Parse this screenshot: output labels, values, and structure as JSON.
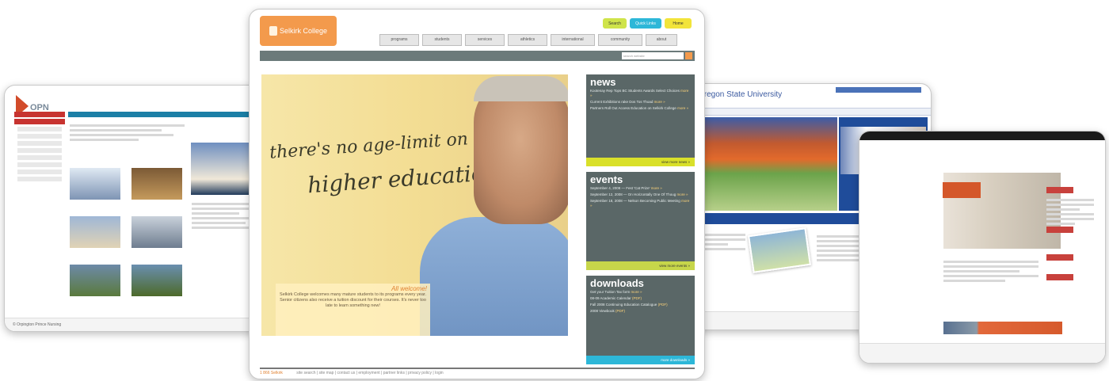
{
  "cards": {
    "a": {
      "logo": "OPN",
      "footer": "© Orpington Prince Nursing"
    },
    "b": {
      "brand": "Selkirk College",
      "util": [
        "Search",
        "Quick Links",
        "Home"
      ],
      "nav": [
        "programs",
        "students",
        "services",
        "athletics",
        "international",
        "community",
        "about"
      ],
      "search_placeholder": "search website",
      "headline": [
        "there's no age-limit on",
        "higher education"
      ],
      "caption": {
        "title": "All welcome!",
        "text": "Selkirk College welcomes many mature students to its programs every year. Senior citizens also receive a tuition discount for their courses. It's never too late to learn something new!"
      },
      "panels": [
        {
          "heading": "news",
          "items": [
            {
              "text": "Kootenay Rep Tops BC Students Awards Select Choices",
              "more": "more »"
            },
            {
              "text": "Current Exhibitions rake Dos Tos Thoad",
              "more": "more »"
            },
            {
              "text": "Partners Roll Out Access Education on Selkirk College",
              "more": "more »"
            }
          ],
          "footer": "view more news »"
        },
        {
          "heading": "events",
          "items": [
            {
              "text": "September 4, 2008 — Fest 'Cat Prize'",
              "more": "more »"
            },
            {
              "text": "September 12, 2008 — On Horizontally One Of Thoug",
              "more": "more »"
            },
            {
              "text": "September 18, 2008 — Nelson Becoming Public Meeting",
              "more": "more »"
            }
          ],
          "footer": "view more events »"
        },
        {
          "heading": "downloads",
          "items": [
            {
              "text": "Get your Tuition Tax form",
              "more": "more »"
            },
            {
              "text": "08-09 Academic Calendar",
              "more": "(PDF)"
            },
            {
              "text": "Fall 2008 Continuing Education Catalogue",
              "more": "(PDF)"
            },
            {
              "text": "2008 Viewbook",
              "more": "(PDF)"
            }
          ],
          "footer": "more downloads »"
        }
      ],
      "footer": {
        "address": "1 866 Selkirk",
        "links": "site search | site map | contact us | employment | partner links | privacy policy | login"
      }
    },
    "c": {
      "title": "Oregon State University"
    }
  }
}
